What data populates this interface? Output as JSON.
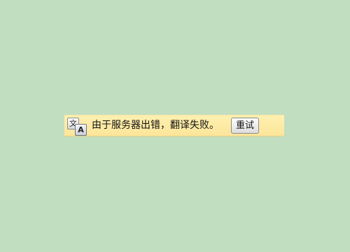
{
  "translation_bar": {
    "icon": {
      "name": "translate-icon",
      "source_glyph": "文",
      "target_glyph": "A"
    },
    "message": "由于服务器出错，翻译失败。",
    "retry_label": "重试"
  },
  "colors": {
    "page_background": "#c1dec0",
    "bar_background": "#fbe59a"
  }
}
